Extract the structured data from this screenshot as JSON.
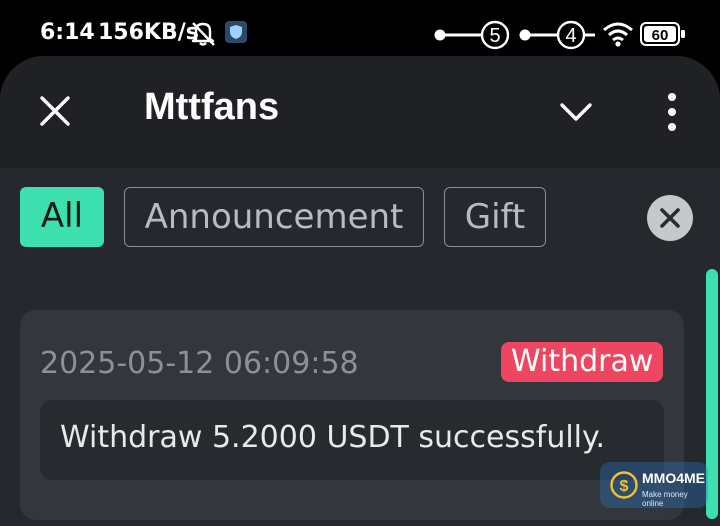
{
  "status_bar": {
    "time": "6:14",
    "network_speed": "156KB/s",
    "sim1_label": "5",
    "sim2_label": "4",
    "battery_level": "60",
    "icons": [
      "bell-off-icon",
      "shield-icon",
      "sim-icon",
      "wifi-icon",
      "battery-icon"
    ]
  },
  "header": {
    "title": "Mttfans",
    "icons": [
      "close-icon",
      "chevron-down-icon",
      "more-vertical-icon"
    ]
  },
  "filters": {
    "tabs": [
      {
        "label": "All",
        "selected": true
      },
      {
        "label": "Announcement",
        "selected": false
      },
      {
        "label": "Gift",
        "selected": false
      }
    ],
    "clear_icon": "close-circle-icon"
  },
  "messages": [
    {
      "timestamp": "2025-05-12 06:09:58",
      "badge": "Withdraw",
      "text": "Withdraw 5.2000 USDT successfully."
    }
  ],
  "watermark": {
    "name": "MMO4ME",
    "tagline": "Make money online"
  },
  "colors": {
    "accent": "#3fe0b0",
    "badge_red": "#ee4660",
    "background": "#25282d",
    "card": "#33363d"
  }
}
